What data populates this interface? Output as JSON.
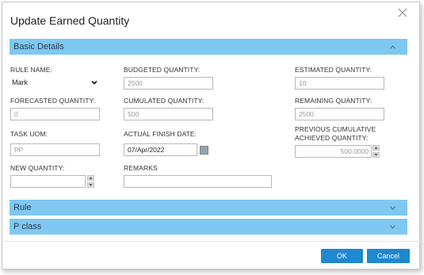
{
  "dialog": {
    "title": "Update Earned Quantity"
  },
  "sections": {
    "basic": "Basic Details",
    "rule": "Rule",
    "pclass": "P class"
  },
  "fields": {
    "rule_name": {
      "label": "RULE NAME:",
      "value": "Mark"
    },
    "budgeted_quantity": {
      "label": "BUDGETED QUANTITY:",
      "value": "2500"
    },
    "estimated_quantity": {
      "label": "ESTIMATED QUANTITY:",
      "value": "10"
    },
    "forecasted_quantity": {
      "label": "FORECASTED QUANTITY:",
      "value": "0"
    },
    "cumulated_quantity": {
      "label": "CUMULATED QUANTITY:",
      "value": "500"
    },
    "remaining_quantity": {
      "label": "REMAINING QUANTITY:",
      "value": "2500"
    },
    "task_uom": {
      "label": "TASK UOM:",
      "value": "PP"
    },
    "actual_finish_date": {
      "label": "ACTUAL FINISH DATE:",
      "value": "07/Apr/2022"
    },
    "previous_cumulative": {
      "label_line1": "PREVIOUS CUMULATIVE",
      "label_line2": "ACHIEVED QUANTITY:",
      "value": "500.0000"
    },
    "new_quantity": {
      "label": "NEW QUANTITY:",
      "value": ""
    },
    "remarks": {
      "label": "REMARKS",
      "value": ""
    }
  },
  "buttons": {
    "ok": "OK",
    "cancel": "Cancel"
  },
  "colors": {
    "section_bar": "#7ec8f2",
    "button": "#1e88d0"
  }
}
